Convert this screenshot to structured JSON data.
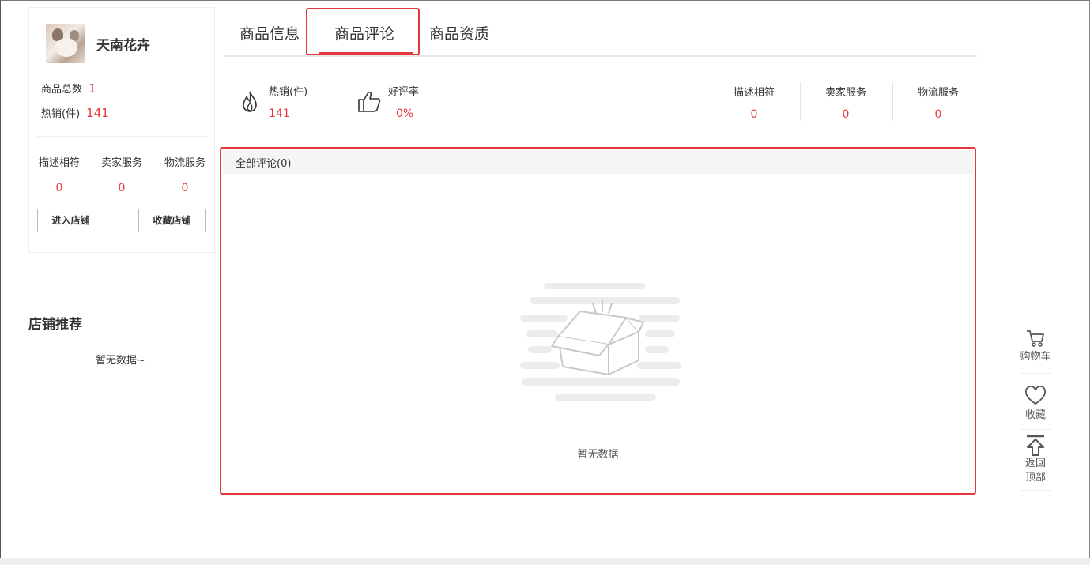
{
  "shop": {
    "name": "天南花卉",
    "total_products_label": "商品总数",
    "total_products_value": "1",
    "hot_sales_label": "热销(件)",
    "hot_sales_value": "141",
    "scores": [
      {
        "label": "描述相符",
        "value": "0"
      },
      {
        "label": "卖家服务",
        "value": "0"
      },
      {
        "label": "物流服务",
        "value": "0"
      }
    ],
    "enter_shop_button": "进入店铺",
    "favorite_shop_button": "收藏店铺"
  },
  "recommend": {
    "title": "店铺推荐",
    "empty_text": "暂无数据~"
  },
  "tabs": [
    {
      "label": "商品信息",
      "active": false
    },
    {
      "label": "商品评论",
      "active": true
    },
    {
      "label": "商品资质",
      "active": false
    }
  ],
  "stats": {
    "hot_sales_label": "热销(件)",
    "hot_sales_value": "141",
    "good_rate_label": "好评率",
    "good_rate_value": "0%",
    "scores": [
      {
        "label": "描述相符",
        "value": "0"
      },
      {
        "label": "卖家服务",
        "value": "0"
      },
      {
        "label": "物流服务",
        "value": "0"
      }
    ]
  },
  "reviews": {
    "all_tab_label": "全部评论(0)",
    "empty_text": "暂无数据"
  },
  "sidebar": {
    "cart_label": "购物车",
    "favorite_label": "收藏",
    "back_to_top_line1": "返回",
    "back_to_top_line2": "顶部"
  },
  "colors": {
    "accent": "#e4393c",
    "text": "#333333",
    "muted_bg": "#f5f5f5"
  }
}
